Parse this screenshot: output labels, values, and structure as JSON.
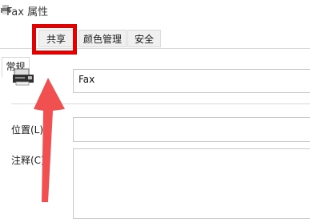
{
  "window": {
    "title": "Fax 属性"
  },
  "tabs": [
    {
      "label": "常规"
    },
    {
      "label": "共享"
    },
    {
      "label": "颜色管理"
    },
    {
      "label": "安全"
    }
  ],
  "general": {
    "printer_name_value": "Fax",
    "location_label": "位置(L)",
    "location_value": "",
    "comment_label": "注释(C)",
    "comment_value": ""
  },
  "icons": {
    "title_icon": "printer-icon",
    "device_icon": "fax-printer-icon"
  },
  "colors": {
    "highlight_box": "#e30000",
    "arrow": "#f0504f"
  }
}
